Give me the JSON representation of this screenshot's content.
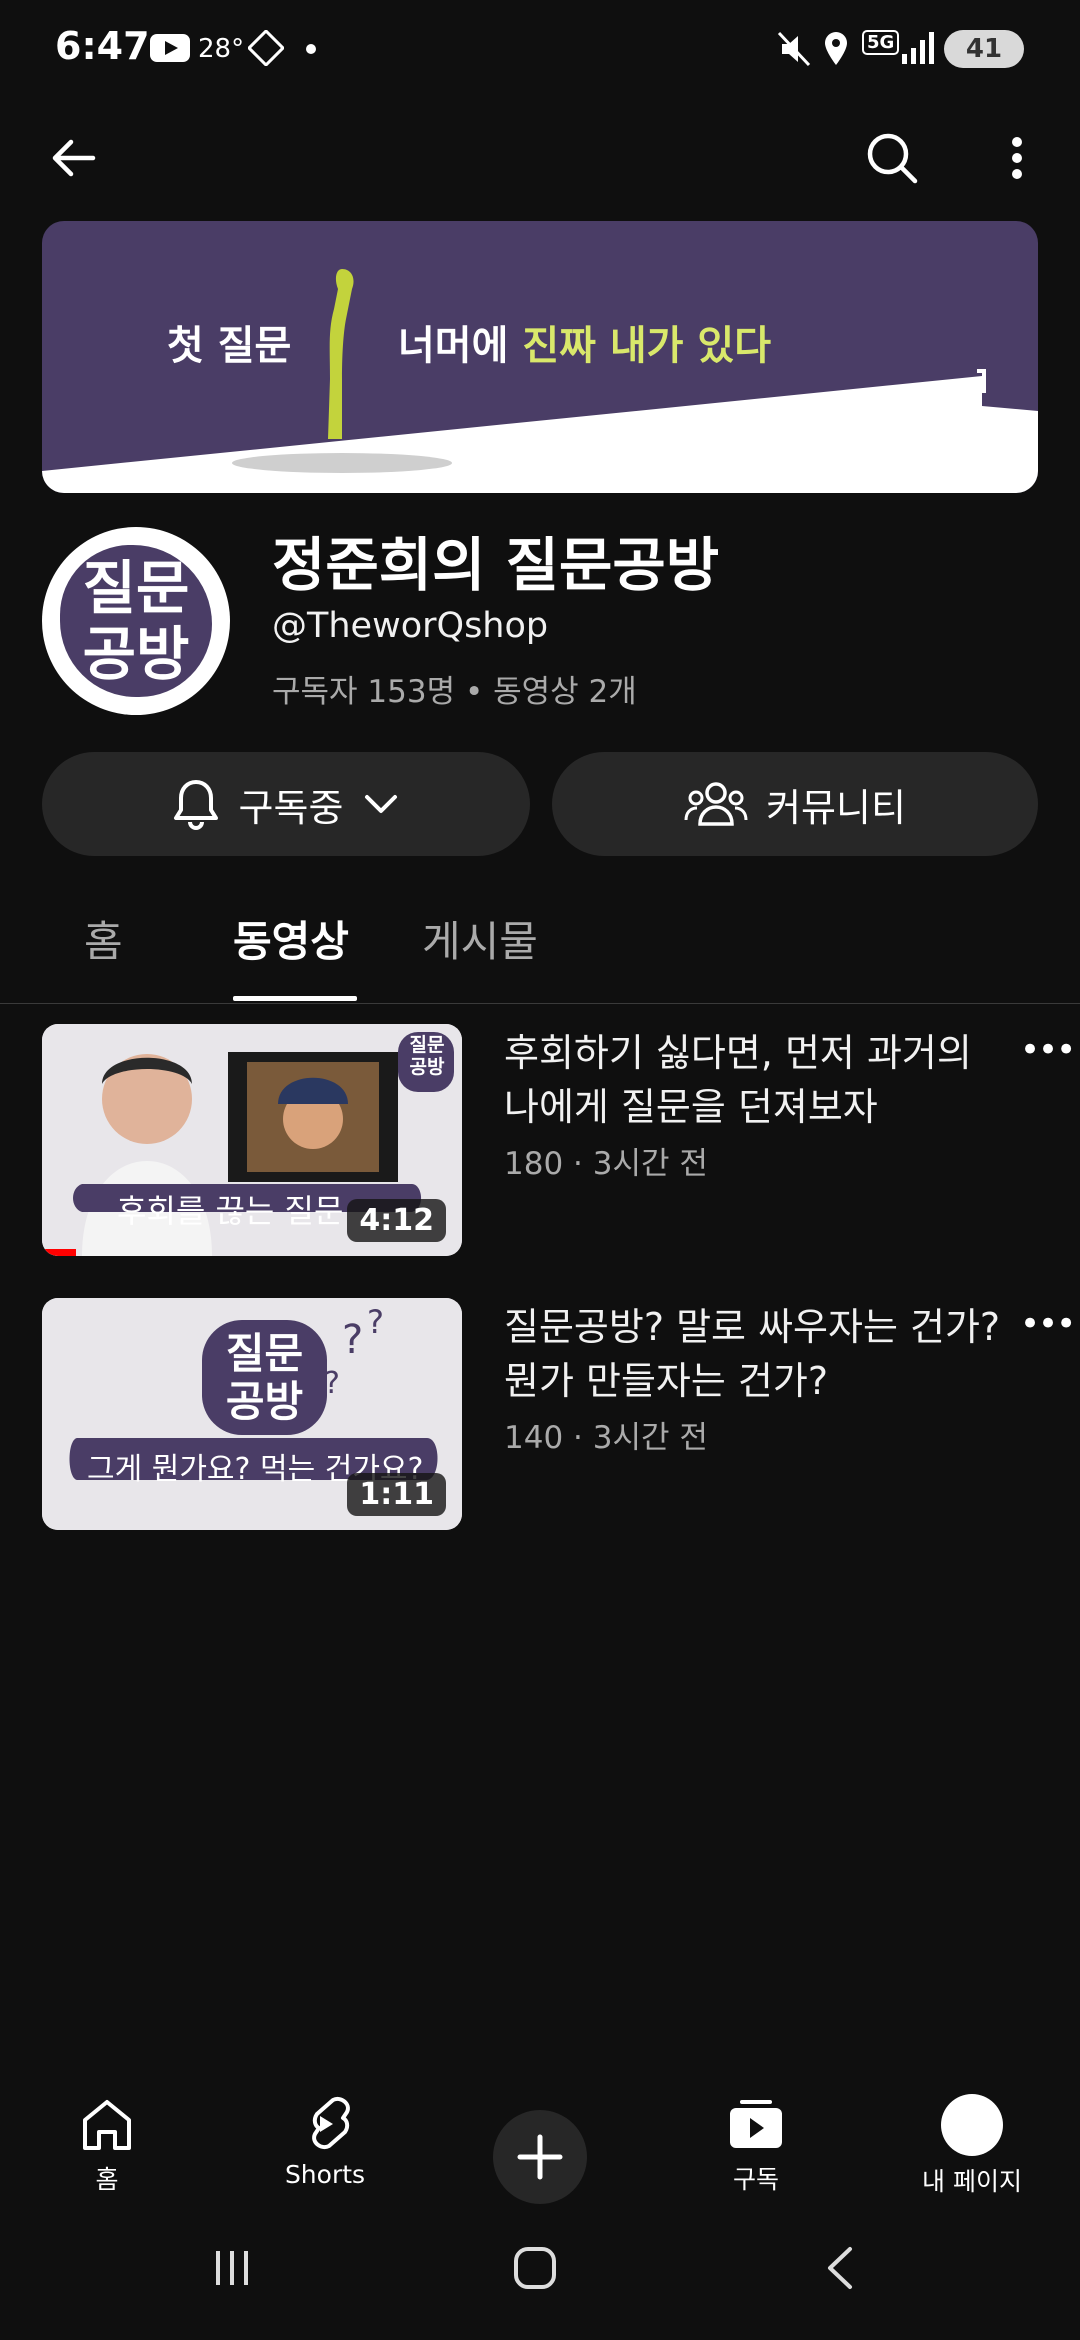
{
  "status_bar": {
    "time": "6:47",
    "temperature": "28°",
    "network": "5G",
    "battery": "41"
  },
  "banner": {
    "text_part1": "첫 질문",
    "text_part2": "너머에",
    "text_highlight": "진짜 내가 있다"
  },
  "channel": {
    "avatar_line1": "질문",
    "avatar_line2": "공방",
    "name": "정준희의 질문공방",
    "handle": "@TheworQshop",
    "stats": "구독자 153명 • 동영상 2개"
  },
  "actions": {
    "subscribe_label": "구독중",
    "community_label": "커뮤니티"
  },
  "tabs": [
    {
      "label": "홈"
    },
    {
      "label": "동영상",
      "active": true
    },
    {
      "label": "게시물"
    }
  ],
  "videos": [
    {
      "title": "후회하기 싫다면, 먼저 과거의 나에게 질문을 던져보자",
      "meta": "180 · 3시간 전",
      "duration": "4:12",
      "thumb_caption": "후회를 끊는 질문",
      "thumb_logo": "질문 공방",
      "watched_progress": 0.08
    },
    {
      "title": "질문공방? 말로 싸우자는 건가? 뭔가 만들자는 건가?",
      "meta": "140 · 3시간 전",
      "duration": "1:11",
      "thumb_caption": "그게 뭔가요? 먹는 건가요?",
      "thumb_logo": "질문 공방"
    }
  ],
  "bottom_nav": [
    {
      "label": "홈",
      "icon": "home-icon"
    },
    {
      "label": "Shorts",
      "icon": "shorts-icon"
    },
    {
      "label": "",
      "icon": "create-icon"
    },
    {
      "label": "구독",
      "icon": "subscriptions-icon"
    },
    {
      "label": "내 페이지",
      "icon": "avatar-icon"
    }
  ],
  "colors": {
    "background": "#0f0f0f",
    "pill": "#272727",
    "banner": "#4a3d66",
    "highlight": "#d9e86b",
    "progress": "#ff0000"
  }
}
